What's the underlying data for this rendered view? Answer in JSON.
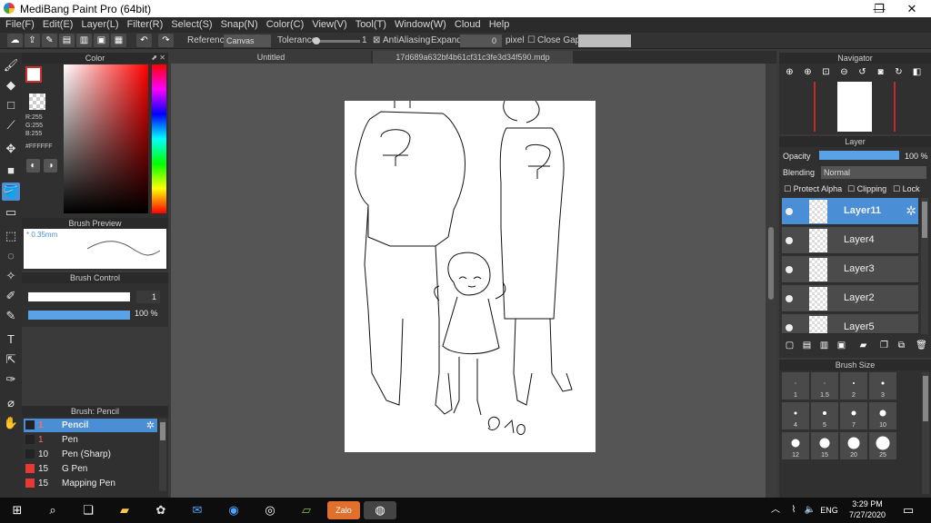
{
  "window": {
    "title": "MediBang Paint Pro (64bit)",
    "minimize_icon": "minimize-icon",
    "maximize_icon": "restore-icon",
    "close_icon": "close-icon"
  },
  "menu": [
    "File(F)",
    "Edit(E)",
    "Layer(L)",
    "Filter(R)",
    "Select(S)",
    "Snap(N)",
    "Color(C)",
    "View(V)",
    "Tool(T)",
    "Window(W)",
    "Cloud",
    "Help"
  ],
  "toolbar": {
    "reference_label": "Reference",
    "reference_value": "Canvas",
    "tolerance_label": "Tolerance",
    "tolerance_value": "1",
    "antialiasing_label": "AntiAliasing",
    "expand_label": "Expand",
    "expand_value": "0",
    "expand_unit": "pixel",
    "close_gaps_label": "Close Gaps"
  },
  "color_panel": {
    "title": "Color",
    "r": "R:255",
    "g": "G:255",
    "b": "B:255",
    "hex": "#FFFFFF"
  },
  "brush_preview": {
    "title": "Brush Preview",
    "size_label": "* 0.35mm"
  },
  "brush_control": {
    "title": "Brush Control",
    "size_value": "1",
    "opacity_value": "100 %",
    "opacity_fraction": 1.0
  },
  "brush_list": {
    "title": "Brush: Pencil",
    "items": [
      {
        "size": "1",
        "name": "Pencil",
        "color": "#222222",
        "selected": true
      },
      {
        "size": "1",
        "name": "Pen",
        "color": "#222222"
      },
      {
        "size": "10",
        "name": "Pen (Sharp)",
        "color": "#222222"
      },
      {
        "size": "15",
        "name": "G Pen",
        "color": "#e53935"
      },
      {
        "size": "15",
        "name": "Mapping Pen",
        "color": "#e53935"
      }
    ]
  },
  "documents": {
    "tab1": "Untitled",
    "tab2": "17d689a632bf4b61cf31c3fe3d34f590.mdp"
  },
  "navigator": {
    "title": "Navigator"
  },
  "layer_panel": {
    "title": "Layer",
    "opacity_label": "Opacity",
    "opacity_value": "100 %",
    "blending_label": "Blending",
    "blending_value": "Normal",
    "protect_alpha": "Protect Alpha",
    "clipping": "Clipping",
    "lock": "Lock",
    "layers": [
      {
        "name": "Layer11",
        "selected": true
      },
      {
        "name": "Layer4"
      },
      {
        "name": "Layer3"
      },
      {
        "name": "Layer2"
      },
      {
        "name": "Layer5"
      }
    ]
  },
  "brush_size": {
    "title": "Brush Size",
    "sizes": [
      "1",
      "1.5",
      "2",
      "3",
      "4",
      "5",
      "7",
      "10",
      "12",
      "15",
      "20",
      "25"
    ]
  },
  "taskbar": {
    "time": "3:29 PM",
    "date": "7/27/2020",
    "lang": "ENG",
    "zalo_label": "Zalo"
  }
}
